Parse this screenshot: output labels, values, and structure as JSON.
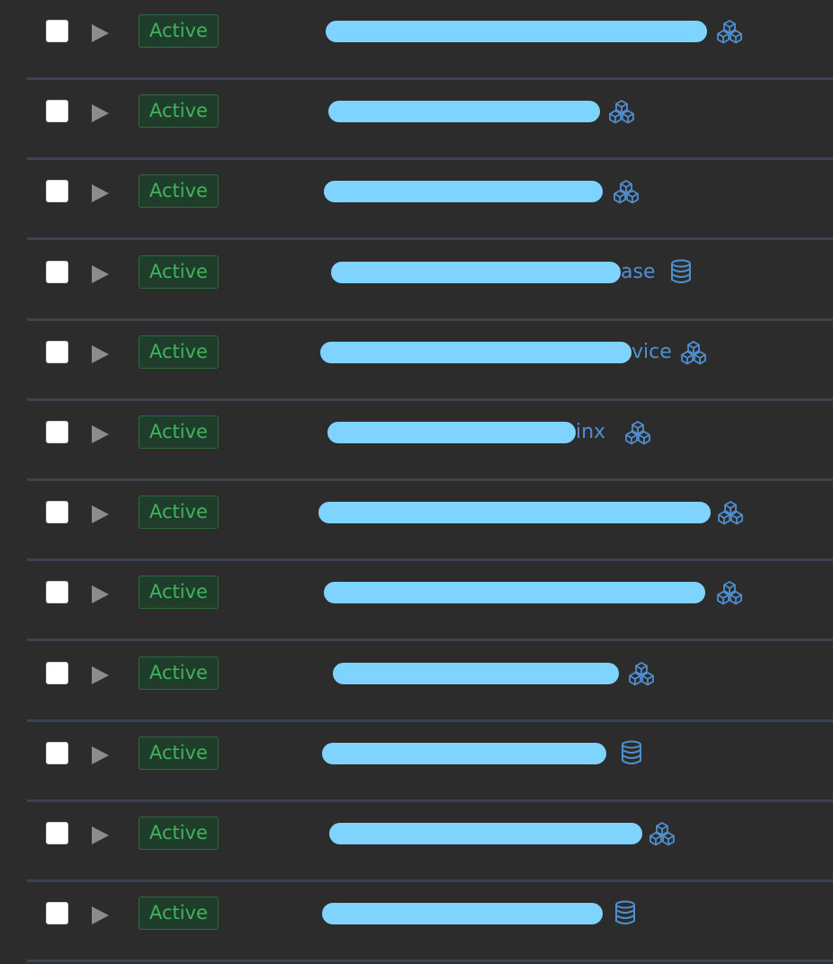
{
  "rows": [
    {
      "checked": false,
      "status": "Active",
      "name_visible": "",
      "type_icon": "cubes-icon"
    },
    {
      "checked": false,
      "status": "Active",
      "name_visible": "",
      "type_icon": "cubes-icon"
    },
    {
      "checked": false,
      "status": "Active",
      "name_visible": "",
      "type_icon": "cubes-icon"
    },
    {
      "checked": false,
      "status": "Active",
      "name_visible": "ase",
      "type_icon": "database-icon"
    },
    {
      "checked": false,
      "status": "Active",
      "name_visible": "vice",
      "type_icon": "cubes-icon"
    },
    {
      "checked": false,
      "status": "Active",
      "name_visible": "inx",
      "type_icon": "cubes-icon"
    },
    {
      "checked": false,
      "status": "Active",
      "name_visible": "",
      "type_icon": "cubes-icon"
    },
    {
      "checked": false,
      "status": "Active",
      "name_visible": "",
      "type_icon": "cubes-icon"
    },
    {
      "checked": false,
      "status": "Active",
      "name_visible": "",
      "type_icon": "cubes-icon"
    },
    {
      "checked": false,
      "status": "Active",
      "name_visible": "",
      "type_icon": "database-icon"
    },
    {
      "checked": false,
      "status": "Active",
      "name_visible": "",
      "type_icon": "cubes-icon"
    },
    {
      "checked": false,
      "status": "Active",
      "name_visible": "",
      "type_icon": "database-icon"
    }
  ],
  "colors": {
    "background": "#2c2c2c",
    "divider": "#3b4350",
    "status_text": "#3fb45e",
    "status_bg": "#1f3d2a",
    "status_border": "#2e6a3f",
    "link": "#4f8fd0",
    "redaction": "#7fd4ff"
  }
}
